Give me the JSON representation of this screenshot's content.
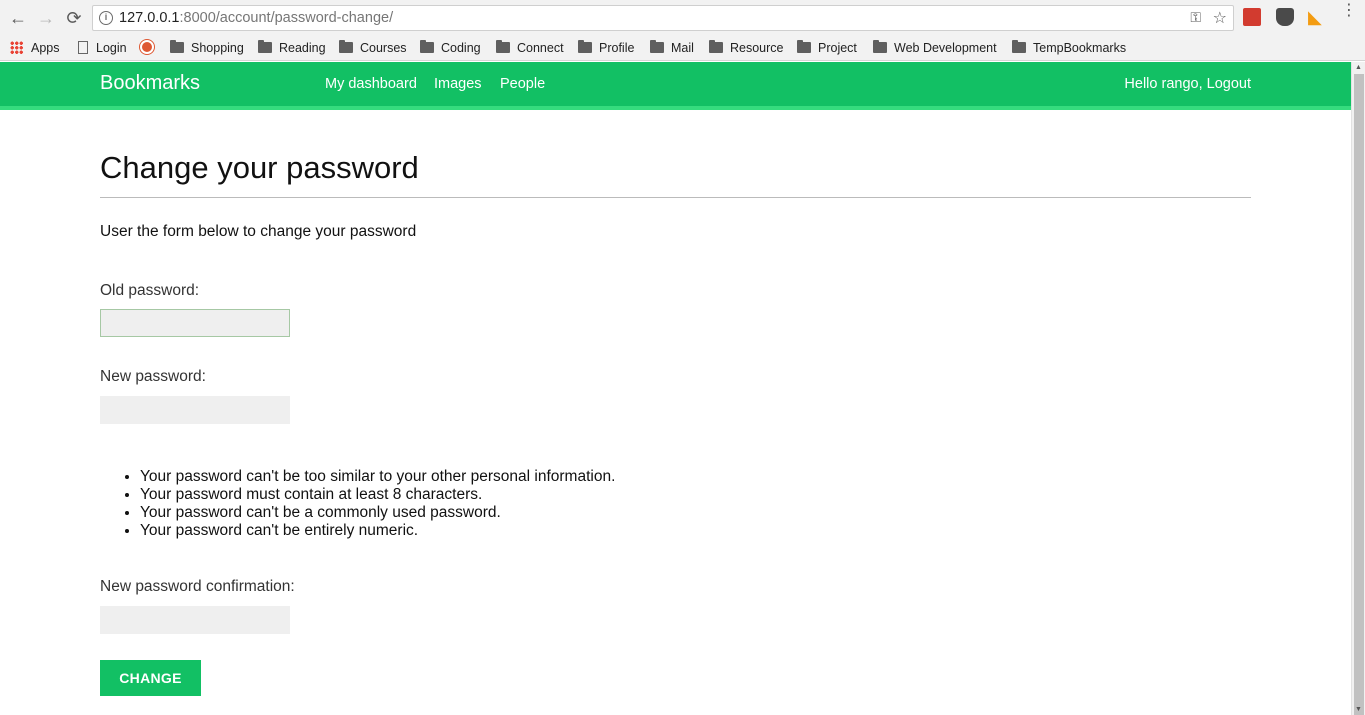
{
  "browser": {
    "url_host": "127.0.0.1",
    "url_path": ":8000/account/password-change/",
    "back_icon": "←",
    "forward_icon": "→",
    "reload_icon": "⟳",
    "info_icon": "i",
    "key_icon": "⚿",
    "star_icon": "☆",
    "rss_icon": "◣",
    "menu_icon": "⋮",
    "bookmarks": [
      {
        "label": "Apps",
        "icon": "apps-grid-icon"
      },
      {
        "label": "Login",
        "icon": "page-icon"
      },
      {
        "label": "Shopping",
        "icon": "duckduckgo-icon"
      },
      {
        "label": "Reading",
        "icon": "folder-icon"
      },
      {
        "label": "Courses",
        "icon": "folder-icon"
      },
      {
        "label": "Coding",
        "icon": "folder-icon"
      },
      {
        "label": "Connect",
        "icon": "folder-icon"
      },
      {
        "label": "Profile",
        "icon": "folder-icon"
      },
      {
        "label": "Mail",
        "icon": "folder-icon"
      },
      {
        "label": "Resource",
        "icon": "folder-icon"
      },
      {
        "label": "Project",
        "icon": "folder-icon"
      },
      {
        "label": "Web Development",
        "icon": "folder-icon"
      },
      {
        "label": "TempBookmarks",
        "icon": "folder-icon"
      }
    ]
  },
  "header": {
    "logo": "Bookmarks",
    "nav": [
      "My dashboard",
      "Images",
      "People"
    ],
    "user": "Hello rango, Logout",
    "color": "#12c064"
  },
  "page": {
    "title": "Change your password",
    "intro": "User the form below to change your password",
    "old_password_label": "Old password:",
    "new_password_label": "New password:",
    "help": [
      "Your password can't be too similar to your other personal information.",
      "Your password must contain at least 8 characters.",
      "Your password can't be a commonly used password.",
      "Your password can't be entirely numeric."
    ],
    "confirm_label": "New password confirmation:",
    "submit_label": "CHANGE"
  }
}
